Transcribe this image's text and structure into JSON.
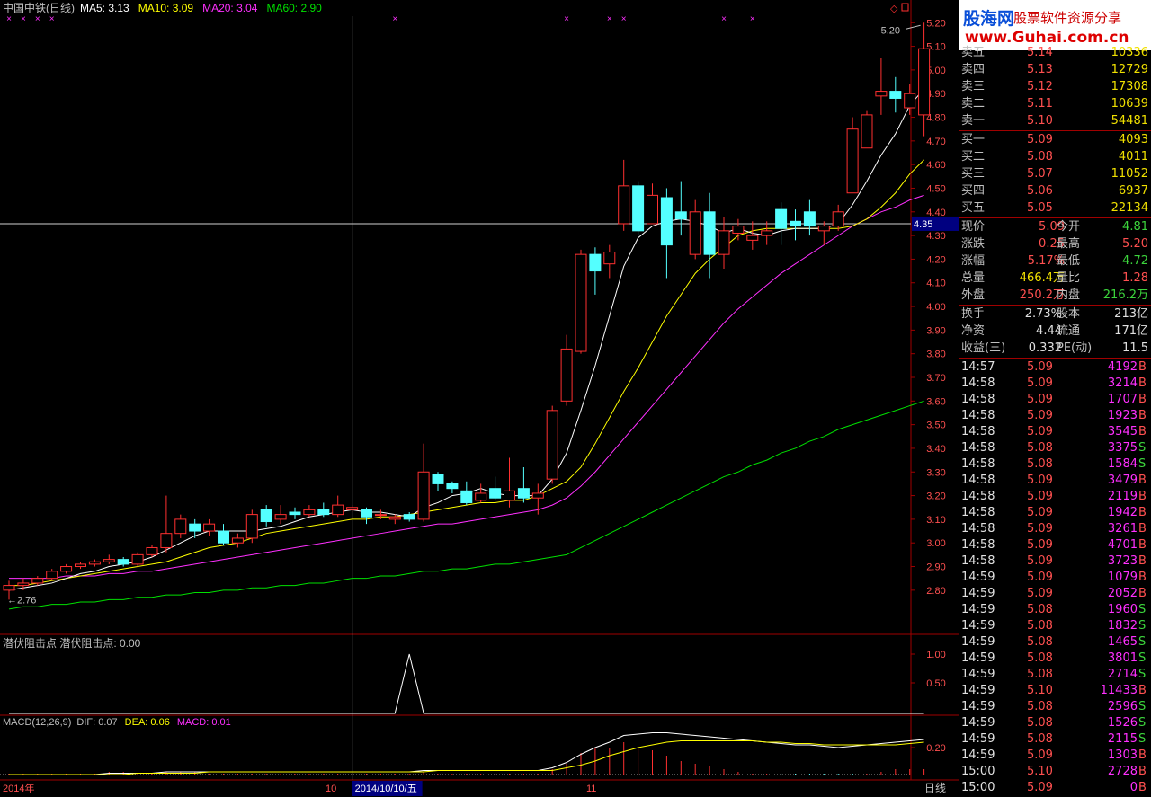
{
  "header": {
    "name": "中国中铁(日线)",
    "ma": [
      {
        "label": "MA5: 3.13",
        "color": "#ffffff"
      },
      {
        "label": "MA10: 3.09",
        "color": "#ffff00"
      },
      {
        "label": "MA20: 3.04",
        "color": "#ff30ff"
      },
      {
        "label": "MA60: 2.90",
        "color": "#00e000"
      }
    ]
  },
  "price_axis": {
    "ticks": [
      "5.20",
      "5.10",
      "5.00",
      "4.90",
      "4.80",
      "4.70",
      "4.60",
      "4.50",
      "4.40",
      "4.30",
      "4.20",
      "4.10",
      "4.00",
      "3.90",
      "3.80",
      "3.70",
      "3.60",
      "3.50",
      "3.40",
      "3.30",
      "3.20",
      "3.10",
      "3.00",
      "2.90",
      "2.80"
    ],
    "cursor_value": "4.35",
    "high_marker": "5.20",
    "low_marker": "2.76"
  },
  "indicator1": {
    "title": "潜伏阻击点  潜伏阻击点: 0.00",
    "ticks": [
      "1.00",
      "0.50"
    ]
  },
  "indicator2": {
    "title": "MACD(12,26,9)",
    "dif": "DIF: 0.07",
    "dea": "DEA: 0.06",
    "macd": "MACD: 0.01",
    "ticks": [
      "0.20"
    ]
  },
  "bottom": {
    "year": "2014年",
    "m10": "10",
    "cursor_date": "2014/10/10/五",
    "m11": "11",
    "period": "日线"
  },
  "logo": {
    "title": "股海网",
    "subtitle": "股票软件资源分享",
    "url": "www.Guhai.com.cn"
  },
  "order_book": {
    "asks": [
      {
        "label": "卖五",
        "price": "5.14",
        "vol": "10336"
      },
      {
        "label": "卖四",
        "price": "5.13",
        "vol": "12729"
      },
      {
        "label": "卖三",
        "price": "5.12",
        "vol": "17308"
      },
      {
        "label": "卖二",
        "price": "5.11",
        "vol": "10639"
      },
      {
        "label": "卖一",
        "price": "5.10",
        "vol": "54481"
      }
    ],
    "bids": [
      {
        "label": "买一",
        "price": "5.09",
        "vol": "4093"
      },
      {
        "label": "买二",
        "price": "5.08",
        "vol": "4011"
      },
      {
        "label": "买三",
        "price": "5.07",
        "vol": "11052"
      },
      {
        "label": "买四",
        "price": "5.06",
        "vol": "6937"
      },
      {
        "label": "买五",
        "price": "5.05",
        "vol": "22134"
      }
    ]
  },
  "quote": [
    {
      "l1": "现价",
      "v1": "5.09",
      "c1": "red",
      "l2": "今开",
      "v2": "4.81",
      "c2": "grn"
    },
    {
      "l1": "涨跌",
      "v1": "0.25",
      "c1": "red",
      "l2": "最高",
      "v2": "5.20",
      "c2": "red"
    },
    {
      "l1": "涨幅",
      "v1": "5.17%",
      "c1": "red",
      "l2": "最低",
      "v2": "4.72",
      "c2": "grn"
    },
    {
      "l1": "总量",
      "v1": "466.4万",
      "c1": "yel",
      "l2": "量比",
      "v2": "1.28",
      "c2": "red"
    },
    {
      "l1": "外盘",
      "v1": "250.2万",
      "c1": "red",
      "l2": "内盘",
      "v2": "216.2万",
      "c2": "grn"
    }
  ],
  "fundamentals": [
    {
      "l1": "换手",
      "v1": "2.73%",
      "l2": "股本",
      "v2": "213亿"
    },
    {
      "l1": "净资",
      "v1": "4.44",
      "l2": "流通",
      "v2": "171亿"
    },
    {
      "l1": "收益(三)",
      "v1": "0.332",
      "l2": "PE(动)",
      "v2": "11.5"
    }
  ],
  "ticks": [
    {
      "t": "14:57",
      "p": "5.09",
      "v": "4192",
      "s": "B"
    },
    {
      "t": "14:58",
      "p": "5.09",
      "v": "3214",
      "s": "B"
    },
    {
      "t": "14:58",
      "p": "5.09",
      "v": "1707",
      "s": "B"
    },
    {
      "t": "14:58",
      "p": "5.09",
      "v": "1923",
      "s": "B"
    },
    {
      "t": "14:58",
      "p": "5.09",
      "v": "3545",
      "s": "B"
    },
    {
      "t": "14:58",
      "p": "5.08",
      "v": "3375",
      "s": "S"
    },
    {
      "t": "14:58",
      "p": "5.08",
      "v": "1584",
      "s": "S"
    },
    {
      "t": "14:58",
      "p": "5.09",
      "v": "3479",
      "s": "B"
    },
    {
      "t": "14:58",
      "p": "5.09",
      "v": "2119",
      "s": "B"
    },
    {
      "t": "14:58",
      "p": "5.09",
      "v": "1942",
      "s": "B"
    },
    {
      "t": "14:58",
      "p": "5.09",
      "v": "3261",
      "s": "B"
    },
    {
      "t": "14:58",
      "p": "5.09",
      "v": "4701",
      "s": "B"
    },
    {
      "t": "14:58",
      "p": "5.09",
      "v": "3723",
      "s": "B"
    },
    {
      "t": "14:59",
      "p": "5.09",
      "v": "1079",
      "s": "B"
    },
    {
      "t": "14:59",
      "p": "5.09",
      "v": "2052",
      "s": "B"
    },
    {
      "t": "14:59",
      "p": "5.08",
      "v": "1960",
      "s": "S"
    },
    {
      "t": "14:59",
      "p": "5.08",
      "v": "1832",
      "s": "S"
    },
    {
      "t": "14:59",
      "p": "5.08",
      "v": "1465",
      "s": "S"
    },
    {
      "t": "14:59",
      "p": "5.08",
      "v": "3801",
      "s": "S"
    },
    {
      "t": "14:59",
      "p": "5.08",
      "v": "2714",
      "s": "S"
    },
    {
      "t": "14:59",
      "p": "5.10",
      "v": "11433",
      "s": "B"
    },
    {
      "t": "14:59",
      "p": "5.08",
      "v": "2596",
      "s": "S"
    },
    {
      "t": "14:59",
      "p": "5.08",
      "v": "1526",
      "s": "S"
    },
    {
      "t": "14:59",
      "p": "5.08",
      "v": "2115",
      "s": "S"
    },
    {
      "t": "14:59",
      "p": "5.09",
      "v": "1303",
      "s": "B"
    },
    {
      "t": "15:00",
      "p": "5.10",
      "v": "2728",
      "s": "B"
    },
    {
      "t": "15:00",
      "p": "5.09",
      "v": "0",
      "s": "B"
    }
  ],
  "chart_data": {
    "type": "candlestick",
    "candles": [
      [
        2.8,
        2.82,
        2.76,
        2.84
      ],
      [
        2.82,
        2.83,
        2.8,
        2.85
      ],
      [
        2.83,
        2.85,
        2.82,
        2.86
      ],
      [
        2.85,
        2.88,
        2.84,
        2.89
      ],
      [
        2.88,
        2.9,
        2.87,
        2.91
      ],
      [
        2.9,
        2.91,
        2.89,
        2.92
      ],
      [
        2.91,
        2.92,
        2.9,
        2.93
      ],
      [
        2.92,
        2.93,
        2.91,
        2.95
      ],
      [
        2.93,
        2.91,
        2.9,
        2.94
      ],
      [
        2.91,
        2.95,
        2.9,
        2.96
      ],
      [
        2.95,
        2.98,
        2.94,
        2.99
      ],
      [
        2.98,
        3.04,
        2.96,
        3.2
      ],
      [
        3.04,
        3.1,
        3.02,
        3.12
      ],
      [
        3.08,
        3.05,
        3.02,
        3.1
      ],
      [
        3.05,
        3.08,
        3.03,
        3.1
      ],
      [
        3.05,
        3.0,
        2.99,
        3.08
      ],
      [
        3.0,
        3.02,
        2.98,
        3.04
      ],
      [
        3.02,
        3.12,
        3.0,
        3.14
      ],
      [
        3.14,
        3.09,
        3.07,
        3.16
      ],
      [
        3.1,
        3.12,
        3.08,
        3.16
      ],
      [
        3.13,
        3.12,
        3.1,
        3.15
      ],
      [
        3.12,
        3.14,
        3.11,
        3.16
      ],
      [
        3.14,
        3.12,
        3.11,
        3.17
      ],
      [
        3.12,
        3.16,
        3.11,
        3.2
      ],
      [
        3.14,
        3.15,
        3.13,
        3.16
      ],
      [
        3.14,
        3.11,
        3.08,
        3.15
      ],
      [
        3.12,
        3.12,
        3.1,
        3.14
      ],
      [
        3.1,
        3.11,
        3.08,
        3.12
      ],
      [
        3.12,
        3.1,
        3.09,
        3.13
      ],
      [
        3.1,
        3.3,
        3.09,
        3.42
      ],
      [
        3.29,
        3.25,
        3.22,
        3.3
      ],
      [
        3.25,
        3.23,
        3.21,
        3.26
      ],
      [
        3.22,
        3.17,
        3.16,
        3.26
      ],
      [
        3.18,
        3.21,
        3.17,
        3.25
      ],
      [
        3.23,
        3.19,
        3.18,
        3.28
      ],
      [
        3.18,
        3.22,
        3.15,
        3.36
      ],
      [
        3.23,
        3.19,
        3.17,
        3.32
      ],
      [
        3.19,
        3.21,
        3.12,
        3.25
      ],
      [
        3.27,
        3.56,
        3.25,
        3.58
      ],
      [
        3.6,
        3.82,
        3.58,
        3.88
      ],
      [
        3.81,
        4.22,
        3.8,
        4.24
      ],
      [
        4.22,
        4.15,
        4.05,
        4.25
      ],
      [
        4.18,
        4.23,
        4.12,
        4.26
      ],
      [
        4.35,
        4.51,
        4.32,
        4.62
      ],
      [
        4.51,
        4.32,
        4.3,
        4.53
      ],
      [
        4.35,
        4.47,
        4.35,
        4.52
      ],
      [
        4.46,
        4.26,
        4.12,
        4.5
      ],
      [
        4.4,
        4.37,
        4.3,
        4.53
      ],
      [
        4.22,
        4.4,
        4.2,
        4.45
      ],
      [
        4.4,
        4.22,
        4.12,
        4.48
      ],
      [
        4.22,
        4.32,
        4.16,
        4.38
      ],
      [
        4.31,
        4.34,
        4.28,
        4.37
      ],
      [
        4.28,
        4.3,
        4.24,
        4.36
      ],
      [
        4.3,
        4.32,
        4.26,
        4.36
      ],
      [
        4.41,
        4.33,
        4.26,
        4.44
      ],
      [
        4.36,
        4.34,
        4.28,
        4.41
      ],
      [
        4.4,
        4.34,
        4.3,
        4.45
      ],
      [
        4.32,
        4.34,
        4.26,
        4.36
      ],
      [
        4.34,
        4.4,
        4.32,
        4.43
      ],
      [
        4.48,
        4.75,
        4.48,
        4.8
      ],
      [
        4.67,
        4.81,
        4.67,
        4.83
      ],
      [
        4.89,
        4.91,
        4.81,
        5.05
      ],
      [
        4.91,
        4.88,
        4.82,
        4.97
      ],
      [
        4.84,
        4.9,
        4.81,
        4.94
      ],
      [
        4.81,
        5.09,
        4.72,
        5.2
      ]
    ],
    "ma5": [
      2.8,
      2.81,
      2.82,
      2.83,
      2.85,
      2.87,
      2.88,
      2.9,
      2.91,
      2.92,
      2.94,
      2.97,
      3.0,
      3.03,
      3.05,
      3.05,
      3.05,
      3.05,
      3.06,
      3.07,
      3.09,
      3.11,
      3.12,
      3.13,
      3.14,
      3.13,
      3.13,
      3.12,
      3.11,
      3.15,
      3.17,
      3.2,
      3.21,
      3.23,
      3.21,
      3.2,
      3.2,
      3.2,
      3.27,
      3.38,
      3.56,
      3.75,
      3.96,
      4.17,
      4.29,
      4.34,
      4.36,
      4.37,
      4.36,
      4.34,
      4.31,
      4.33,
      4.31,
      4.3,
      4.32,
      4.33,
      4.33,
      4.33,
      4.35,
      4.43,
      4.53,
      4.64,
      4.73,
      4.85,
      4.92
    ],
    "ma10": [
      2.82,
      2.82,
      2.83,
      2.84,
      2.85,
      2.86,
      2.87,
      2.88,
      2.89,
      2.9,
      2.91,
      2.92,
      2.94,
      2.96,
      2.98,
      2.99,
      3.0,
      3.02,
      3.04,
      3.05,
      3.06,
      3.07,
      3.08,
      3.09,
      3.1,
      3.1,
      3.11,
      3.11,
      3.12,
      3.13,
      3.14,
      3.15,
      3.16,
      3.17,
      3.17,
      3.18,
      3.18,
      3.2,
      3.23,
      3.26,
      3.32,
      3.42,
      3.53,
      3.64,
      3.74,
      3.85,
      3.96,
      4.05,
      4.14,
      4.2,
      4.25,
      4.3,
      4.32,
      4.33,
      4.33,
      4.33,
      4.33,
      4.33,
      4.33,
      4.34,
      4.37,
      4.42,
      4.48,
      4.56,
      4.62
    ],
    "ma20": [
      2.85,
      2.85,
      2.85,
      2.85,
      2.86,
      2.86,
      2.86,
      2.87,
      2.87,
      2.88,
      2.88,
      2.89,
      2.9,
      2.91,
      2.92,
      2.93,
      2.94,
      2.95,
      2.96,
      2.97,
      2.98,
      2.99,
      3.0,
      3.01,
      3.02,
      3.03,
      3.04,
      3.05,
      3.06,
      3.07,
      3.08,
      3.08,
      3.09,
      3.1,
      3.11,
      3.12,
      3.13,
      3.14,
      3.16,
      3.19,
      3.24,
      3.3,
      3.37,
      3.44,
      3.51,
      3.58,
      3.65,
      3.72,
      3.79,
      3.86,
      3.93,
      3.99,
      4.04,
      4.09,
      4.14,
      4.18,
      4.22,
      4.26,
      4.3,
      4.34,
      4.37,
      4.4,
      4.42,
      4.45,
      4.47
    ],
    "ma60": [
      2.72,
      2.73,
      2.73,
      2.74,
      2.74,
      2.75,
      2.75,
      2.76,
      2.76,
      2.77,
      2.77,
      2.78,
      2.78,
      2.79,
      2.79,
      2.8,
      2.8,
      2.81,
      2.81,
      2.82,
      2.82,
      2.83,
      2.83,
      2.84,
      2.85,
      2.85,
      2.86,
      2.86,
      2.87,
      2.88,
      2.88,
      2.89,
      2.89,
      2.9,
      2.91,
      2.91,
      2.92,
      2.93,
      2.94,
      2.95,
      2.98,
      3.01,
      3.04,
      3.07,
      3.1,
      3.13,
      3.16,
      3.19,
      3.22,
      3.25,
      3.28,
      3.3,
      3.33,
      3.35,
      3.38,
      3.4,
      3.43,
      3.45,
      3.48,
      3.5,
      3.52,
      3.54,
      3.56,
      3.58,
      3.6
    ],
    "signal_index": 28,
    "cursor_index": 24,
    "marker_indices": [
      0,
      1,
      2,
      3,
      27,
      39,
      42,
      43,
      50,
      52
    ],
    "macd_dif": [
      0.0,
      0.0,
      0.0,
      0.0,
      0.0,
      0.0,
      0.0,
      0.01,
      0.01,
      0.01,
      0.01,
      0.02,
      0.02,
      0.02,
      0.02,
      0.02,
      0.02,
      0.02,
      0.02,
      0.02,
      0.02,
      0.02,
      0.02,
      0.02,
      0.02,
      0.02,
      0.02,
      0.02,
      0.02,
      0.03,
      0.03,
      0.03,
      0.03,
      0.03,
      0.03,
      0.03,
      0.03,
      0.03,
      0.05,
      0.09,
      0.15,
      0.2,
      0.24,
      0.29,
      0.3,
      0.31,
      0.31,
      0.3,
      0.29,
      0.28,
      0.27,
      0.26,
      0.25,
      0.24,
      0.23,
      0.22,
      0.22,
      0.21,
      0.2,
      0.21,
      0.22,
      0.23,
      0.24,
      0.25,
      0.26
    ],
    "macd_dea": [
      0.0,
      0.0,
      0.0,
      0.0,
      0.0,
      0.0,
      0.0,
      0.0,
      0.0,
      0.01,
      0.01,
      0.01,
      0.01,
      0.01,
      0.02,
      0.02,
      0.02,
      0.02,
      0.02,
      0.02,
      0.02,
      0.02,
      0.02,
      0.02,
      0.02,
      0.02,
      0.02,
      0.02,
      0.02,
      0.02,
      0.03,
      0.03,
      0.03,
      0.03,
      0.03,
      0.03,
      0.03,
      0.03,
      0.03,
      0.05,
      0.07,
      0.1,
      0.14,
      0.17,
      0.2,
      0.22,
      0.24,
      0.25,
      0.25,
      0.25,
      0.25,
      0.25,
      0.25,
      0.24,
      0.24,
      0.23,
      0.23,
      0.22,
      0.22,
      0.22,
      0.22,
      0.22,
      0.22,
      0.23,
      0.24
    ]
  }
}
